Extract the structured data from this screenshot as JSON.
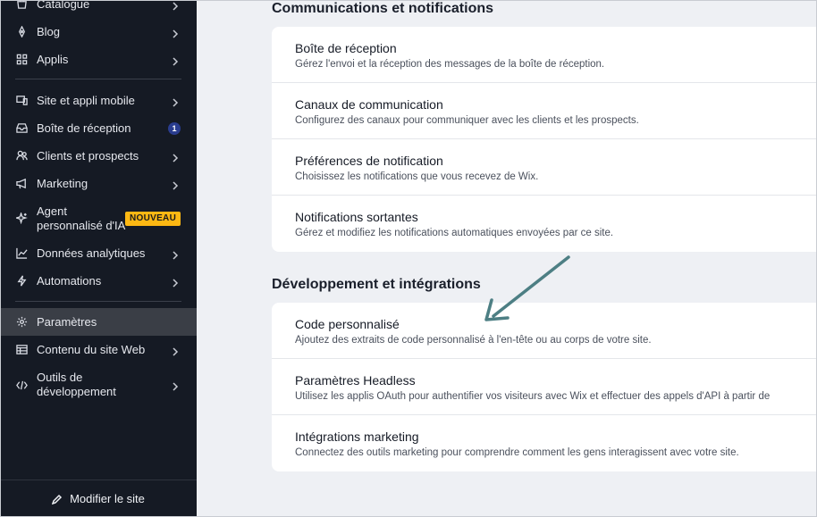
{
  "sidebar": {
    "items": [
      {
        "label": "Catalogue",
        "icon": "catalogue-icon"
      },
      {
        "label": "Blog",
        "icon": "blog-icon"
      },
      {
        "label": "Applis",
        "icon": "apps-icon"
      },
      {
        "label": "Site et appli mobile",
        "icon": "site-mobile-icon"
      },
      {
        "label": "Boîte de réception",
        "icon": "inbox-icon",
        "badge": "1"
      },
      {
        "label": "Clients et prospects",
        "icon": "clients-icon"
      },
      {
        "label": "Marketing",
        "icon": "megaphone-icon"
      },
      {
        "label": "Agent personnalisé d'IA",
        "icon": "ai-sparkle-icon",
        "badge_new": "NOUVEAU"
      },
      {
        "label": "Données analytiques",
        "icon": "analytics-icon"
      },
      {
        "label": "Automations",
        "icon": "automations-icon"
      },
      {
        "label": "Paramètres",
        "icon": "gear-icon"
      },
      {
        "label": "Contenu du site Web",
        "icon": "cms-icon"
      },
      {
        "label": "Outils de développement",
        "icon": "code-icon"
      }
    ],
    "footer_label": "Modifier le site"
  },
  "main": {
    "sections": [
      {
        "title": "Communications et notifications",
        "rows": [
          {
            "title": "Boîte de réception",
            "desc": "Gérez l'envoi et la réception des messages de la boîte de réception."
          },
          {
            "title": "Canaux de communication",
            "desc": "Configurez des canaux pour communiquer avec les clients et les prospects."
          },
          {
            "title": "Préférences de notification",
            "desc": "Choisissez les notifications que vous recevez de Wix."
          },
          {
            "title": "Notifications sortantes",
            "desc": "Gérez et modifiez les notifications automatiques envoyées par ce site."
          }
        ]
      },
      {
        "title": "Développement et intégrations",
        "rows": [
          {
            "title": "Code personnalisé",
            "desc": "Ajoutez des extraits de code personnalisé à l'en-tête ou au corps de votre site."
          },
          {
            "title": "Paramètres Headless",
            "desc": "Utilisez les applis OAuth pour authentifier vos visiteurs avec Wix et effectuer des appels d'API à partir de"
          },
          {
            "title": "Intégrations marketing",
            "desc": "Connectez des outils marketing pour comprendre comment les gens interagissent avec votre site."
          }
        ]
      }
    ]
  },
  "colors": {
    "sidebar_bg": "#151a24",
    "active_bg": "#3a3e46",
    "badge_new": "#fdb813",
    "annotation_arrow": "#4d7f84"
  }
}
